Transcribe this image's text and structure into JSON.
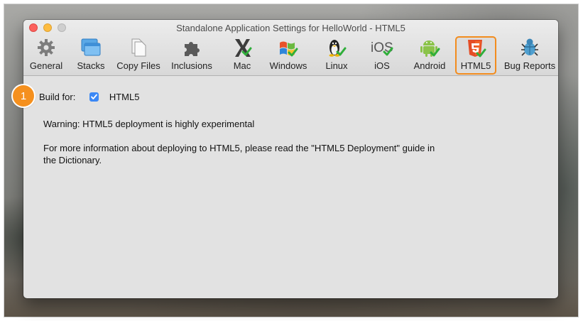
{
  "window": {
    "title": "Standalone Application Settings for HelloWorld - HTML5"
  },
  "toolbar": {
    "items": [
      {
        "label": "General",
        "icon": "gear-icon"
      },
      {
        "label": "Stacks",
        "icon": "stacks-icon"
      },
      {
        "label": "Copy Files",
        "icon": "copy-files-icon"
      },
      {
        "label": "Inclusions",
        "icon": "puzzle-icon"
      },
      {
        "label": "Mac",
        "icon": "mac-x-check-icon"
      },
      {
        "label": "Windows",
        "icon": "windows-logo-check-icon"
      },
      {
        "label": "Linux",
        "icon": "linux-penguin-check-icon"
      },
      {
        "label": "iOS",
        "icon": "ios-check-icon"
      },
      {
        "label": "Android",
        "icon": "android-check-icon"
      },
      {
        "label": "HTML5",
        "icon": "html5-check-icon",
        "selected": true
      },
      {
        "label": "Bug Reports",
        "icon": "bug-icon"
      }
    ],
    "selected_accent": "#f28c1e"
  },
  "annotation": {
    "number": "1",
    "color": "#f5901e"
  },
  "build": {
    "label": "Build for:",
    "checkbox_label": "HTML5",
    "checked": true
  },
  "warning": "Warning: HTML5 deployment is highly experimental",
  "info_line1": "For more information about deploying to HTML5, please read the \"HTML5 Deployment\" guide in",
  "info_line2": "the Dictionary."
}
